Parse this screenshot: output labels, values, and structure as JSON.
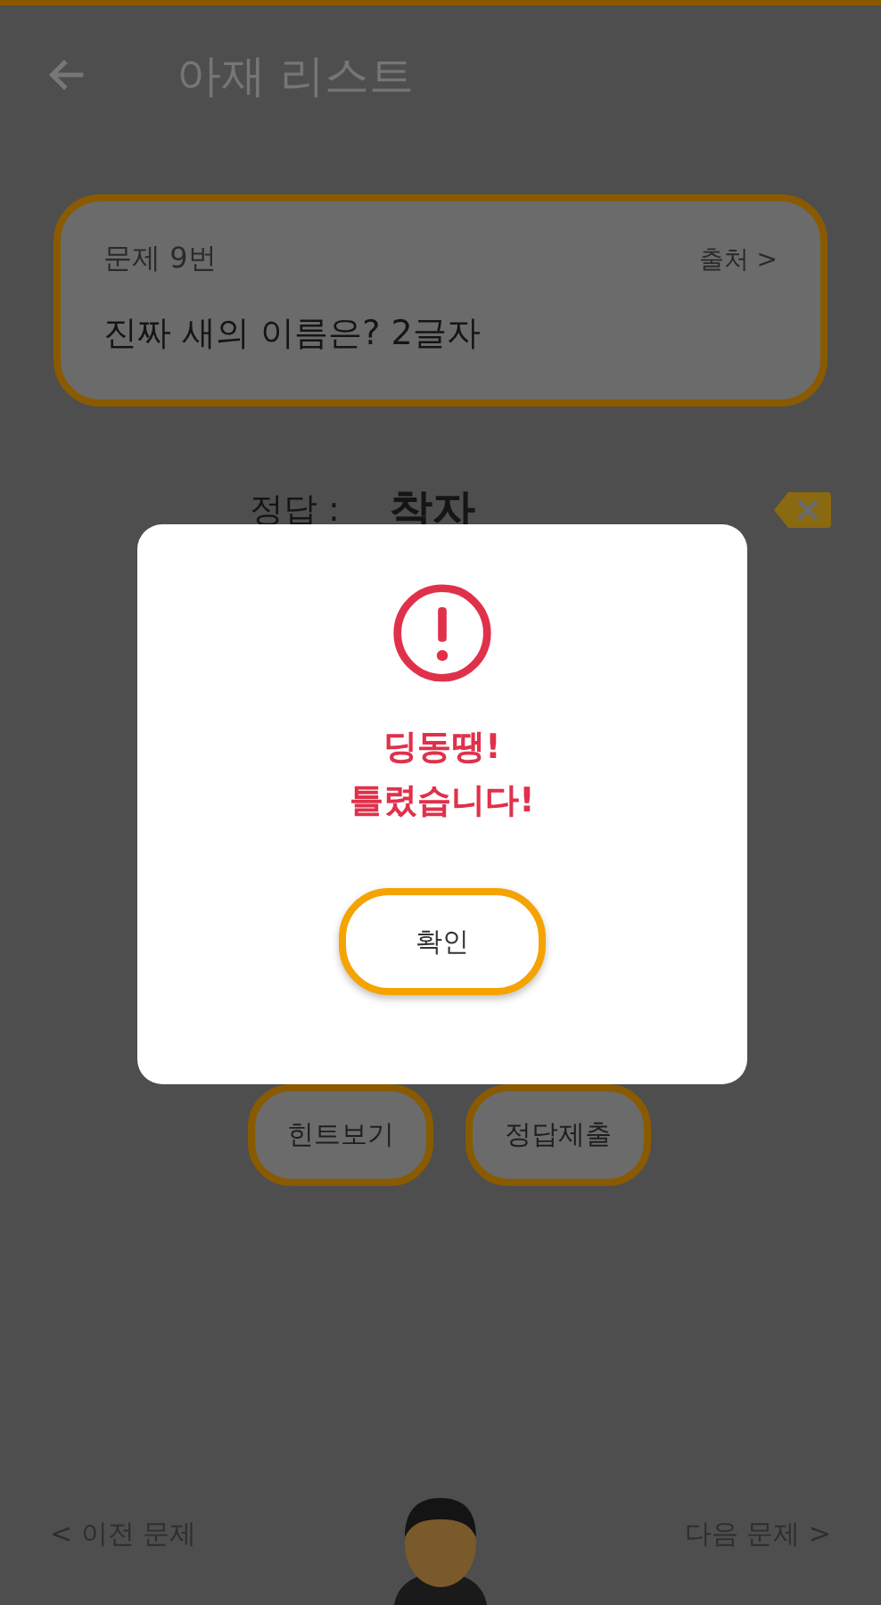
{
  "header": {
    "title": "아재 리스트"
  },
  "question": {
    "number_label": "문제 9번",
    "source_link": "출처 >",
    "text": "진짜 새의 이름은? 2글자"
  },
  "answer": {
    "label": "정답 :",
    "value": "착자"
  },
  "buttons": [
    "힌트보기",
    "정답제출"
  ],
  "footer": {
    "previous": "< 이전 문제",
    "next": "다음 문제 >"
  },
  "dialog": {
    "message_lines": [
      "딩동땡!",
      "틀렸습니다!"
    ],
    "confirm": "확인"
  }
}
